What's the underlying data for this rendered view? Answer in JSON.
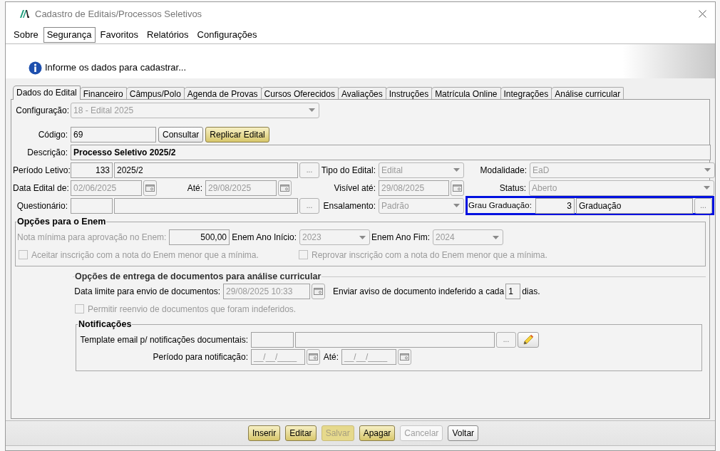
{
  "window": {
    "title": "Cadastro de Editais/Processos Seletivos"
  },
  "menu": [
    {
      "label": "Sobre",
      "selected": false
    },
    {
      "label": "Segurança",
      "selected": true
    },
    {
      "label": "Favoritos",
      "selected": false
    },
    {
      "label": "Relatórios",
      "selected": false
    },
    {
      "label": "Configurações",
      "selected": false
    }
  ],
  "info": "Informe os dados para cadastrar...",
  "tabs": [
    {
      "label": "Dados do Edital",
      "selected": true
    },
    {
      "label": "Financeiro",
      "selected": false
    },
    {
      "label": "Câmpus/Polo",
      "selected": false
    },
    {
      "label": "Agenda de Provas",
      "selected": false
    },
    {
      "label": "Cursos Oferecidos",
      "selected": false
    },
    {
      "label": "Avaliações",
      "selected": false
    },
    {
      "label": "Instruções",
      "selected": false
    },
    {
      "label": "Matrícula Online",
      "selected": false
    },
    {
      "label": "Integrações",
      "selected": false
    },
    {
      "label": "Análise curricular",
      "selected": false
    }
  ],
  "form": {
    "configuracao": {
      "label": "Configuração:",
      "value": "18 - Edital 2025",
      "disabled": true
    },
    "codigo": {
      "label": "Código:",
      "value": "69",
      "buttons": [
        {
          "label": "Consultar",
          "kind": "plain"
        },
        {
          "label": "Replicar Edital",
          "kind": "gold"
        }
      ]
    },
    "descricao": {
      "label": "Descrição:",
      "value": "Processo Seletivo 2025/2"
    },
    "periodo_letivo": {
      "label": "Período Letivo:",
      "code": "133",
      "value": "2025/2",
      "button": "..."
    },
    "tipo_edital": {
      "label": "Tipo do Edital:",
      "value": "Edital",
      "disabled": true
    },
    "modalidade": {
      "label": "Modalidade:",
      "value": "EaD",
      "disabled": true
    },
    "data_edital_de": {
      "label": "Data Edital de:",
      "value": "02/06/2025",
      "disabled": true
    },
    "data_edital_ate": {
      "label": "Até:",
      "value": "29/08/2025",
      "disabled": true
    },
    "visivel_ate": {
      "label": "Visível até:",
      "value": "29/08/2025",
      "disabled": true
    },
    "status": {
      "label": "Status:",
      "value": "Aberto",
      "disabled": true
    },
    "questionario": {
      "label": "Questionário:",
      "button": "..."
    },
    "ensalamento": {
      "label": "Ensalamento:",
      "value": "Padrão",
      "disabled": true
    },
    "grau_graduacao": {
      "label": "Grau Graduação:",
      "code": "3",
      "value": "Graduação",
      "button": "...",
      "highlighted": true
    }
  },
  "enem": {
    "title": "Opções para o Enem",
    "nota": {
      "label": "Nota mínima para aprovação no Enem:",
      "value": "500,00",
      "disabled": true
    },
    "ano_inicio": {
      "label": "Enem Ano Início:",
      "value": "2023",
      "disabled": true
    },
    "ano_fim": {
      "label": "Enem Ano Fim:",
      "value": "2024",
      "disabled": true
    },
    "checkboxes": [
      {
        "label": "Aceitar inscrição com a nota do Enem menor que a mínima.",
        "checked": false,
        "disabled": true
      },
      {
        "label": "Reprovar inscrição com a nota do Enem menor que a mínima.",
        "checked": false,
        "disabled": true
      }
    ]
  },
  "entrega": {
    "title": "Opções de entrega de documentos para análise curricular",
    "data_limite": {
      "label": "Data limite para envio de documentos:",
      "value": "29/08/2025 10:33",
      "disabled": true
    },
    "aviso": {
      "prefix": "Enviar aviso de documento indeferido a cada",
      "value": "1",
      "suffix": "dias."
    },
    "checkbox": {
      "label": "Permitir reenvio de documentos que foram indeferidos.",
      "checked": false,
      "disabled": true
    },
    "notificacoes": {
      "title": "Notificações",
      "template": {
        "label": "Template email p/ notificações documentais:",
        "button": "..."
      },
      "periodo": {
        "label": "Período para notificação:",
        "value": "__/__/____",
        "ate_label": "Até:",
        "ate_value": "__/__/____"
      }
    }
  },
  "buttons": [
    {
      "label": "Inserir",
      "kind": "gold",
      "disabled": false
    },
    {
      "label": "Editar",
      "kind": "gold",
      "disabled": false
    },
    {
      "label": "Salvar",
      "kind": "gold",
      "disabled": true
    },
    {
      "label": "Apagar",
      "kind": "gold",
      "disabled": false
    },
    {
      "label": "Cancelar",
      "kind": "plain",
      "disabled": true
    },
    {
      "label": "Voltar",
      "kind": "plain",
      "disabled": false
    }
  ]
}
